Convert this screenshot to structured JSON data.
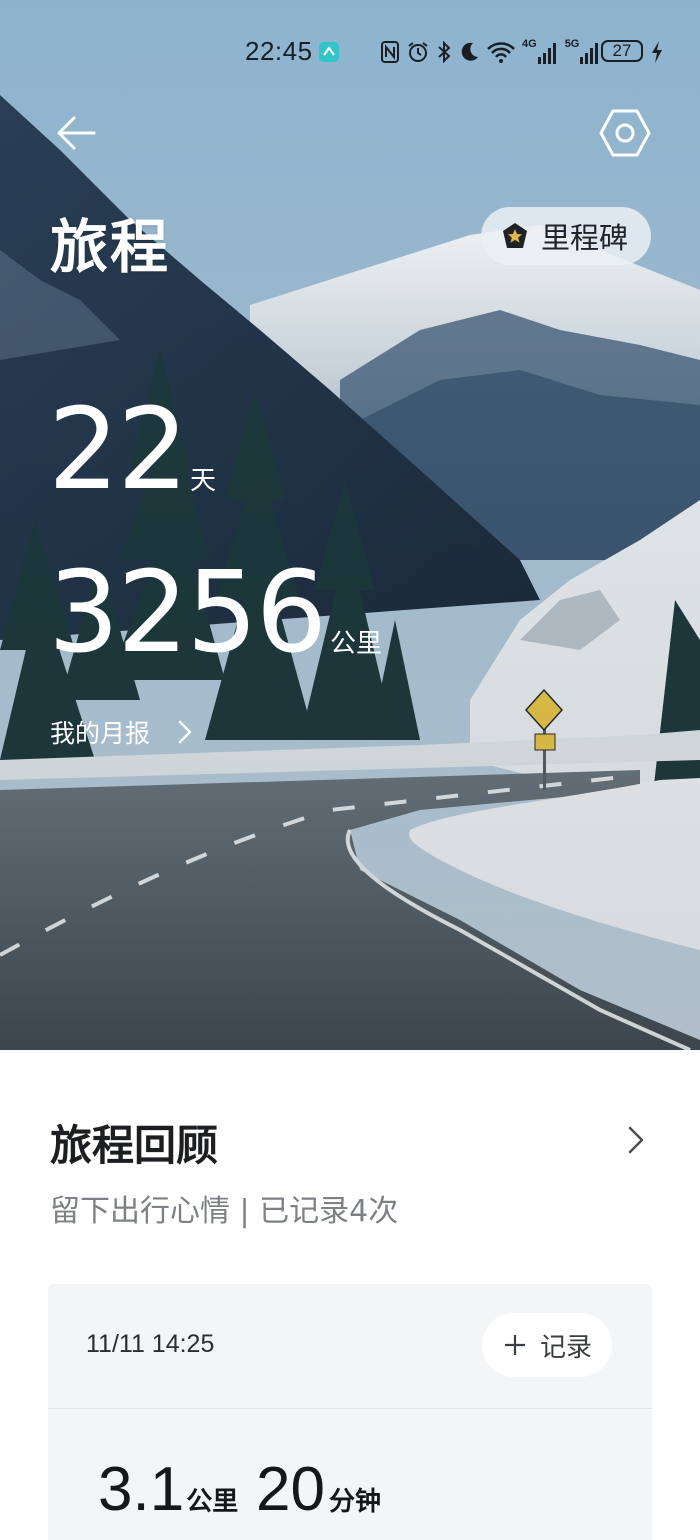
{
  "status_bar": {
    "time": "22:45",
    "battery_level": "27",
    "icons": [
      "app-notification-icon",
      "nfc-icon",
      "alarm-icon",
      "bluetooth-icon",
      "do-not-disturb-moon-icon",
      "wifi-icon",
      "signal-4g-icon",
      "signal-5g-icon",
      "charging-bolt-icon"
    ],
    "network_labels": {
      "first": "4G",
      "second": "5G"
    }
  },
  "header": {
    "title": "旅程",
    "back_icon": "back-arrow-icon",
    "settings_icon": "settings-hexagon-icon",
    "milestone_label": "里程碑",
    "milestone_icon": "star-badge-icon"
  },
  "stats": {
    "days_value": "22",
    "days_unit": "天",
    "distance_value": "3256",
    "distance_unit": "公里"
  },
  "monthly_report": {
    "label": "我的月报"
  },
  "review": {
    "title": "旅程回顾",
    "subtitle": "留下出行心情 | 已记录4次"
  },
  "record_card": {
    "datetime": "11/11 14:25",
    "add_button_label": "记录",
    "distance_value": "3.1",
    "distance_unit": "公里",
    "duration_value": "20",
    "duration_unit": "分钟"
  },
  "colors": {
    "hero_sky": "#a9c4d8",
    "forest": "#233548",
    "snow": "#eef2f5",
    "road": "#4f5a63",
    "text_dark": "#1c1e21",
    "text_muted": "#7d8186",
    "card_bg": "#f4f5f6",
    "milestone_star": "#e0b84a"
  }
}
